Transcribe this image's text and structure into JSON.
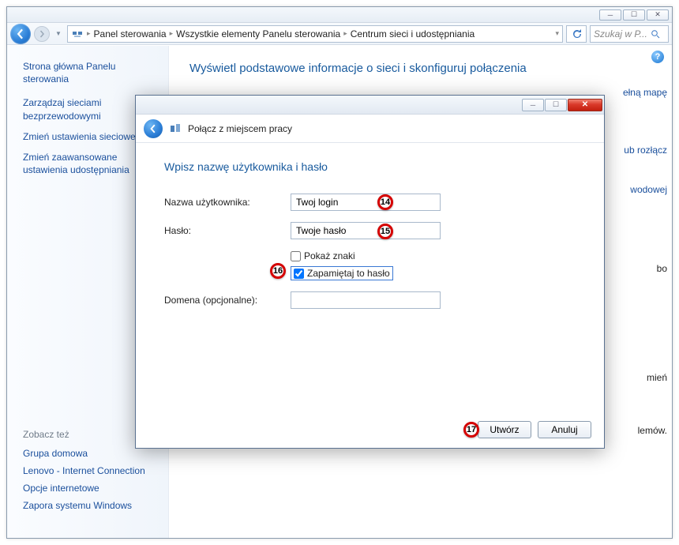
{
  "outer": {
    "breadcrumbs": [
      "Panel sterowania",
      "Wszystkie elementy Panelu sterowania",
      "Centrum sieci i udostępniania"
    ],
    "search_placeholder": "Szukaj w P...",
    "main_title": "Wyświetl podstawowe informacje o sieci i skonfiguruj połączenia",
    "fragments": {
      "map": "ełną mapę",
      "disconnect": "ub rozłącz",
      "wireless": "wodowej",
      "or": "bo",
      "change": "mień",
      "problems": "lemów."
    }
  },
  "sidebar": {
    "home": "Strona główna Panelu sterowania",
    "links": [
      "Zarządzaj sieciami bezprzewodowymi",
      "Zmień ustawienia sieciowej",
      "Zmień zaawansowane ustawienia udostępniania"
    ],
    "see_also": "Zobacz też",
    "bottom_links": [
      "Grupa domowa",
      "Lenovo - Internet Connection",
      "Opcje internetowe",
      "Zapora systemu Windows"
    ]
  },
  "dialog": {
    "title": "Połącz z miejscem pracy",
    "heading": "Wpisz nazwę użytkownika i hasło",
    "username_label": "Nazwa użytkownika:",
    "username_value": "Twoj login",
    "password_label": "Hasło:",
    "password_value": "Twoje hasło",
    "show_chars": "Pokaż znaki",
    "remember": "Zapamiętaj to hasło",
    "domain_label": "Domena (opcjonalne):",
    "domain_value": "",
    "create_btn": "Utwórz",
    "cancel_btn": "Anuluj"
  },
  "annotations": {
    "a14": "14",
    "a15": "15",
    "a16": "16",
    "a17": "17"
  }
}
